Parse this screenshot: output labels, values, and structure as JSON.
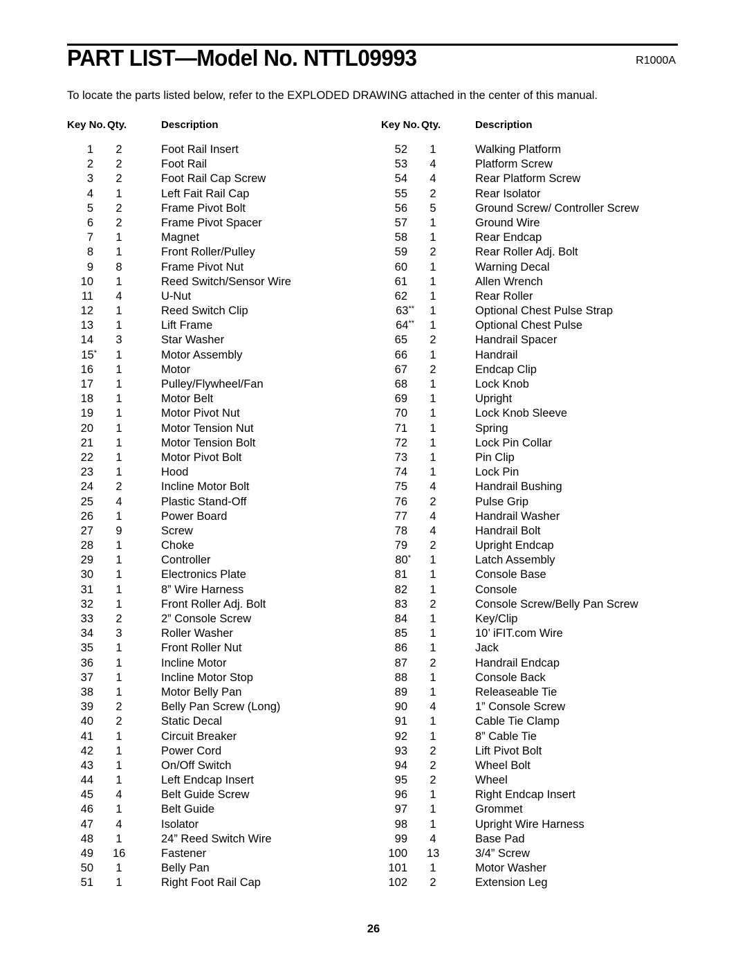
{
  "header": {
    "title": "PART LIST—Model No. NTTL09993",
    "doc_code": "R1000A",
    "intro": "To locate the parts listed below, refer to the EXPLODED DRAWING attached in the center of this manual."
  },
  "columns_headers": {
    "key": "Key No.",
    "qty": "Qty.",
    "desc": "Description"
  },
  "left_parts": [
    {
      "key": "1",
      "mark": "",
      "qty": "2",
      "desc": "Foot Rail Insert"
    },
    {
      "key": "2",
      "mark": "",
      "qty": "2",
      "desc": "Foot Rail"
    },
    {
      "key": "3",
      "mark": "",
      "qty": "2",
      "desc": "Foot Rail Cap Screw"
    },
    {
      "key": "4",
      "mark": "",
      "qty": "1",
      "desc": "Left Fait Rail Cap"
    },
    {
      "key": "5",
      "mark": "",
      "qty": "2",
      "desc": "Frame Pivot Bolt"
    },
    {
      "key": "6",
      "mark": "",
      "qty": "2",
      "desc": "Frame Pivot Spacer"
    },
    {
      "key": "7",
      "mark": "",
      "qty": "1",
      "desc": "Magnet"
    },
    {
      "key": "8",
      "mark": "",
      "qty": "1",
      "desc": "Front Roller/Pulley"
    },
    {
      "key": "9",
      "mark": "",
      "qty": "8",
      "desc": "Frame Pivot Nut"
    },
    {
      "key": "10",
      "mark": "",
      "qty": "1",
      "desc": "Reed Switch/Sensor Wire"
    },
    {
      "key": "11",
      "mark": "",
      "qty": "4",
      "desc": "U-Nut"
    },
    {
      "key": "12",
      "mark": "",
      "qty": "1",
      "desc": "Reed Switch Clip"
    },
    {
      "key": "13",
      "mark": "",
      "qty": "1",
      "desc": "Lift Frame"
    },
    {
      "key": "14",
      "mark": "",
      "qty": "3",
      "desc": "Star Washer"
    },
    {
      "key": "15",
      "mark": "*",
      "qty": "1",
      "desc": "Motor Assembly"
    },
    {
      "key": "16",
      "mark": "",
      "qty": "1",
      "desc": "Motor"
    },
    {
      "key": "17",
      "mark": "",
      "qty": "1",
      "desc": "Pulley/Flywheel/Fan"
    },
    {
      "key": "18",
      "mark": "",
      "qty": "1",
      "desc": "Motor Belt"
    },
    {
      "key": "19",
      "mark": "",
      "qty": "1",
      "desc": "Motor Pivot Nut"
    },
    {
      "key": "20",
      "mark": "",
      "qty": "1",
      "desc": "Motor Tension Nut"
    },
    {
      "key": "21",
      "mark": "",
      "qty": "1",
      "desc": "Motor Tension Bolt"
    },
    {
      "key": "22",
      "mark": "",
      "qty": "1",
      "desc": "Motor Pivot Bolt"
    },
    {
      "key": "23",
      "mark": "",
      "qty": "1",
      "desc": "Hood"
    },
    {
      "key": "24",
      "mark": "",
      "qty": "2",
      "desc": "Incline Motor Bolt"
    },
    {
      "key": "25",
      "mark": "",
      "qty": "4",
      "desc": "Plastic Stand-Off"
    },
    {
      "key": "26",
      "mark": "",
      "qty": "1",
      "desc": "Power Board"
    },
    {
      "key": "27",
      "mark": "",
      "qty": "9",
      "desc": "Screw"
    },
    {
      "key": "28",
      "mark": "",
      "qty": "1",
      "desc": "Choke"
    },
    {
      "key": "29",
      "mark": "",
      "qty": "1",
      "desc": "Controller"
    },
    {
      "key": "30",
      "mark": "",
      "qty": "1",
      "desc": "Electronics Plate"
    },
    {
      "key": "31",
      "mark": "",
      "qty": "1",
      "desc": "8” Wire Harness"
    },
    {
      "key": "32",
      "mark": "",
      "qty": "1",
      "desc": "Front Roller Adj. Bolt"
    },
    {
      "key": "33",
      "mark": "",
      "qty": "2",
      "desc": "2” Console Screw"
    },
    {
      "key": "34",
      "mark": "",
      "qty": "3",
      "desc": "Roller Washer"
    },
    {
      "key": "35",
      "mark": "",
      "qty": "1",
      "desc": "Front Roller Nut"
    },
    {
      "key": "36",
      "mark": "",
      "qty": "1",
      "desc": "Incline Motor"
    },
    {
      "key": "37",
      "mark": "",
      "qty": "1",
      "desc": "Incline Motor Stop"
    },
    {
      "key": "38",
      "mark": "",
      "qty": "1",
      "desc": "Motor Belly Pan"
    },
    {
      "key": "39",
      "mark": "",
      "qty": "2",
      "desc": "Belly Pan Screw (Long)"
    },
    {
      "key": "40",
      "mark": "",
      "qty": "2",
      "desc": "Static Decal"
    },
    {
      "key": "41",
      "mark": "",
      "qty": "1",
      "desc": "Circuit Breaker"
    },
    {
      "key": "42",
      "mark": "",
      "qty": "1",
      "desc": "Power Cord"
    },
    {
      "key": "43",
      "mark": "",
      "qty": "1",
      "desc": "On/Off Switch"
    },
    {
      "key": "44",
      "mark": "",
      "qty": "1",
      "desc": "Left Endcap Insert"
    },
    {
      "key": "45",
      "mark": "",
      "qty": "4",
      "desc": "Belt Guide Screw"
    },
    {
      "key": "46",
      "mark": "",
      "qty": "1",
      "desc": "Belt Guide"
    },
    {
      "key": "47",
      "mark": "",
      "qty": "4",
      "desc": "Isolator"
    },
    {
      "key": "48",
      "mark": "",
      "qty": "1",
      "desc": "24” Reed Switch Wire"
    },
    {
      "key": "49",
      "mark": "",
      "qty": "16",
      "desc": "Fastener"
    },
    {
      "key": "50",
      "mark": "",
      "qty": "1",
      "desc": "Belly Pan"
    },
    {
      "key": "51",
      "mark": "",
      "qty": "1",
      "desc": "Right Foot Rail Cap"
    }
  ],
  "right_parts": [
    {
      "key": "52",
      "mark": "",
      "qty": "1",
      "desc": "Walking Platform"
    },
    {
      "key": "53",
      "mark": "",
      "qty": "4",
      "desc": "Platform Screw"
    },
    {
      "key": "54",
      "mark": "",
      "qty": "4",
      "desc": "Rear Platform Screw"
    },
    {
      "key": "55",
      "mark": "",
      "qty": "2",
      "desc": "Rear Isolator"
    },
    {
      "key": "56",
      "mark": "",
      "qty": "5",
      "desc": "Ground Screw/ Controller Screw"
    },
    {
      "key": "57",
      "mark": "",
      "qty": "1",
      "desc": "Ground Wire"
    },
    {
      "key": "58",
      "mark": "",
      "qty": "1",
      "desc": "Rear Endcap"
    },
    {
      "key": "59",
      "mark": "",
      "qty": "2",
      "desc": "Rear Roller Adj. Bolt"
    },
    {
      "key": "60",
      "mark": "",
      "qty": "1",
      "desc": "Warning Decal"
    },
    {
      "key": "61",
      "mark": "",
      "qty": "1",
      "desc": "Allen Wrench"
    },
    {
      "key": "62",
      "mark": "",
      "qty": "1",
      "desc": "Rear Roller"
    },
    {
      "key": "63",
      "mark": "**",
      "qty": "1",
      "desc": "Optional Chest Pulse Strap"
    },
    {
      "key": "64",
      "mark": "**",
      "qty": "1",
      "desc": "Optional Chest Pulse"
    },
    {
      "key": "65",
      "mark": "",
      "qty": "2",
      "desc": "Handrail Spacer"
    },
    {
      "key": "66",
      "mark": "",
      "qty": "1",
      "desc": "Handrail"
    },
    {
      "key": "67",
      "mark": "",
      "qty": "2",
      "desc": "Endcap Clip"
    },
    {
      "key": "68",
      "mark": "",
      "qty": "1",
      "desc": "Lock Knob"
    },
    {
      "key": "69",
      "mark": "",
      "qty": "1",
      "desc": "Upright"
    },
    {
      "key": "70",
      "mark": "",
      "qty": "1",
      "desc": "Lock Knob Sleeve"
    },
    {
      "key": "71",
      "mark": "",
      "qty": "1",
      "desc": "Spring"
    },
    {
      "key": "72",
      "mark": "",
      "qty": "1",
      "desc": "Lock Pin Collar"
    },
    {
      "key": "73",
      "mark": "",
      "qty": "1",
      "desc": "Pin Clip"
    },
    {
      "key": "74",
      "mark": "",
      "qty": "1",
      "desc": "Lock Pin"
    },
    {
      "key": "75",
      "mark": "",
      "qty": "4",
      "desc": "Handrail Bushing"
    },
    {
      "key": "76",
      "mark": "",
      "qty": "2",
      "desc": "Pulse Grip"
    },
    {
      "key": "77",
      "mark": "",
      "qty": "4",
      "desc": "Handrail Washer"
    },
    {
      "key": "78",
      "mark": "",
      "qty": "4",
      "desc": "Handrail Bolt"
    },
    {
      "key": "79",
      "mark": "",
      "qty": "2",
      "desc": "Upright Endcap"
    },
    {
      "key": "80",
      "mark": "*",
      "qty": "1",
      "desc": "Latch Assembly"
    },
    {
      "key": "81",
      "mark": "",
      "qty": "1",
      "desc": "Console Base"
    },
    {
      "key": "82",
      "mark": "",
      "qty": "1",
      "desc": "Console"
    },
    {
      "key": "83",
      "mark": "",
      "qty": "2",
      "desc": "Console Screw/Belly Pan Screw"
    },
    {
      "key": "84",
      "mark": "",
      "qty": "1",
      "desc": "Key/Clip"
    },
    {
      "key": "85",
      "mark": "",
      "qty": "1",
      "desc": "10’ iFIT.com Wire"
    },
    {
      "key": "86",
      "mark": "",
      "qty": "1",
      "desc": "Jack"
    },
    {
      "key": "87",
      "mark": "",
      "qty": "2",
      "desc": "Handrail Endcap"
    },
    {
      "key": "88",
      "mark": "",
      "qty": "1",
      "desc": "Console Back"
    },
    {
      "key": "89",
      "mark": "",
      "qty": "1",
      "desc": "Releaseable Tie"
    },
    {
      "key": "90",
      "mark": "",
      "qty": "4",
      "desc": "1” Console Screw"
    },
    {
      "key": "91",
      "mark": "",
      "qty": "1",
      "desc": "Cable Tie Clamp"
    },
    {
      "key": "92",
      "mark": "",
      "qty": "1",
      "desc": "8” Cable Tie"
    },
    {
      "key": "93",
      "mark": "",
      "qty": "2",
      "desc": "Lift Pivot Bolt"
    },
    {
      "key": "94",
      "mark": "",
      "qty": "2",
      "desc": "Wheel Bolt"
    },
    {
      "key": "95",
      "mark": "",
      "qty": "2",
      "desc": "Wheel"
    },
    {
      "key": "96",
      "mark": "",
      "qty": "1",
      "desc": "Right Endcap Insert"
    },
    {
      "key": "97",
      "mark": "",
      "qty": "1",
      "desc": "Grommet"
    },
    {
      "key": "98",
      "mark": "",
      "qty": "1",
      "desc": "Upright Wire Harness"
    },
    {
      "key": "99",
      "mark": "",
      "qty": "4",
      "desc": "Base Pad"
    },
    {
      "key": "100",
      "mark": "",
      "qty": "13",
      "desc": "3/4” Screw"
    },
    {
      "key": "101",
      "mark": "",
      "qty": "1",
      "desc": "Motor Washer"
    },
    {
      "key": "102",
      "mark": "",
      "qty": "2",
      "desc": "Extension Leg"
    }
  ],
  "footer": {
    "page_number": "26"
  }
}
